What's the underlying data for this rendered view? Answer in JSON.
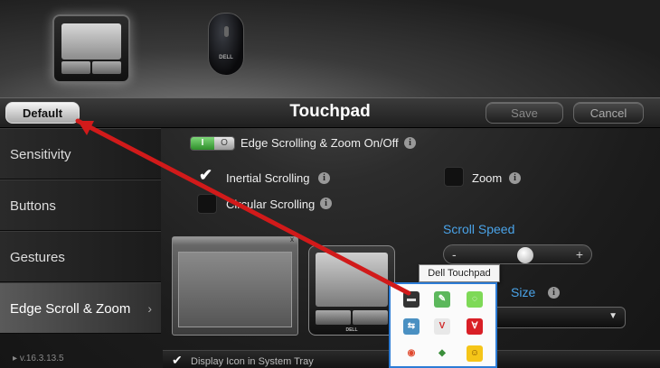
{
  "header": {
    "title": "Touchpad",
    "default_label": "Default",
    "save_label": "Save",
    "cancel_label": "Cancel"
  },
  "devices": {
    "mouse_brand": "DELL",
    "preview_brand": "DELL"
  },
  "sidebar": {
    "items": [
      {
        "label": "Sensitivity"
      },
      {
        "label": "Buttons"
      },
      {
        "label": "Gestures"
      },
      {
        "label": "Edge Scroll & Zoom"
      }
    ],
    "active_index": 3,
    "chevron": "›",
    "version": "v.16.3.13.5"
  },
  "main": {
    "master_toggle": {
      "on_label": "I",
      "off_label": "O",
      "label": "Edge Scrolling & Zoom On/Off",
      "state": "on"
    },
    "inertial_scrolling": {
      "label": "Inertial Scrolling",
      "checked": true
    },
    "circular_scrolling": {
      "label": "Circular Scrolling",
      "checked": false
    },
    "zoom": {
      "label": "Zoom",
      "checked": false
    },
    "scroll_speed": {
      "title": "Scroll Speed",
      "minus": "-",
      "plus": "+",
      "value": 0.48
    },
    "scroll_size": {
      "title": "Size",
      "selected": ""
    }
  },
  "tray": {
    "display_icon_label": "Display Icon in System Tray",
    "display_icon_checked": true,
    "tooltip": "Dell Touchpad",
    "icons": [
      {
        "name": "dell-touchpad-tray-icon",
        "glyph": "▬",
        "bg": "#333333",
        "fg": "#dddddd"
      },
      {
        "name": "evernote-tray-icon",
        "glyph": "✎",
        "bg": "#5cb85c",
        "fg": "#ffffff"
      },
      {
        "name": "green-leaf-tray-icon",
        "glyph": "◌",
        "bg": "#7ed957",
        "fg": "#ffffff"
      },
      {
        "name": "network-tray-icon",
        "glyph": "⇆",
        "bg": "#4a90c2",
        "fg": "#ffffff"
      },
      {
        "name": "vivaldi-tray-icon",
        "glyph": "V",
        "bg": "#e8e8e8",
        "fg": "#d12b2b"
      },
      {
        "name": "avira-tray-icon",
        "glyph": "Ɐ",
        "bg": "#d91f26",
        "fg": "#ffffff"
      },
      {
        "name": "chrome-tray-icon",
        "glyph": "◉",
        "bg": "#fbfbfb",
        "fg": "#e04a2f"
      },
      {
        "name": "update-tray-icon",
        "glyph": "◆",
        "bg": "#fbfbfb",
        "fg": "#3b8f3b"
      },
      {
        "name": "emoji-tray-icon",
        "glyph": "☺",
        "bg": "#f5c518",
        "fg": "#7a4a00"
      }
    ]
  },
  "annotation": {
    "color": "#d11a1a"
  }
}
